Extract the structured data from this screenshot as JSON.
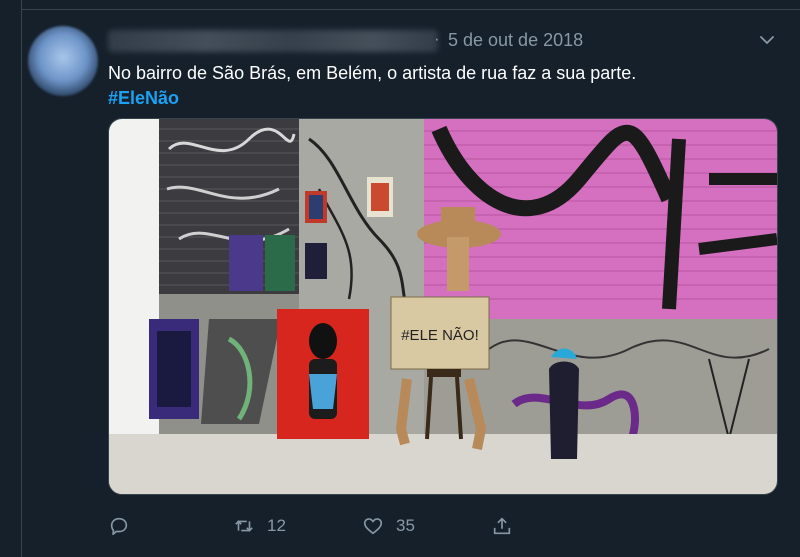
{
  "tweet": {
    "timestamp": "5 de out de 2018",
    "separator": "·",
    "text": "No bairro de São Brás, em Belém, o artista de rua faz a sua parte.",
    "hashtag": "#EleNão",
    "media": {
      "sign_text": "#ELE NÃO!"
    }
  },
  "actions": {
    "reply": {
      "icon": "reply-icon"
    },
    "retweet": {
      "icon": "retweet-icon",
      "count": "12"
    },
    "like": {
      "icon": "heart-icon",
      "count": "35"
    },
    "share": {
      "icon": "share-icon"
    }
  },
  "colors": {
    "background": "#15202b",
    "muted_text": "#8899a6",
    "link": "#1da1f2",
    "divider": "#38444d"
  }
}
